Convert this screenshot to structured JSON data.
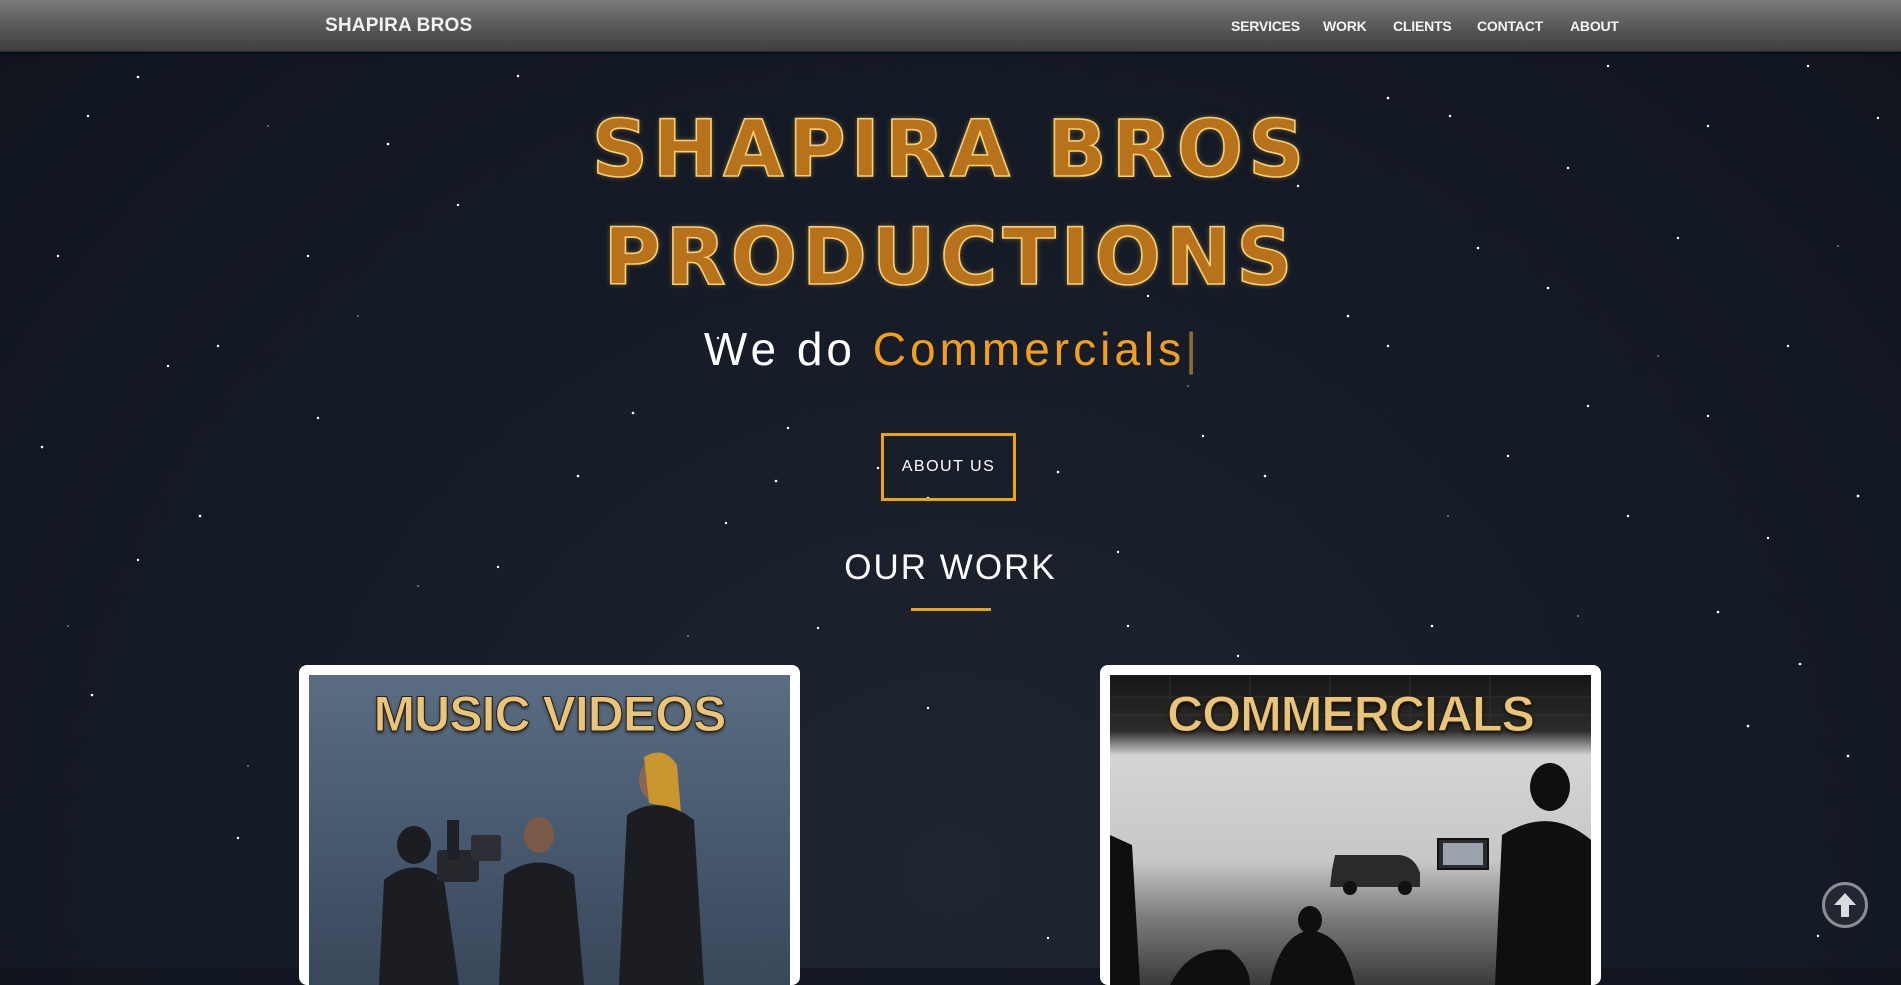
{
  "navbar": {
    "brand": "SHAPIRA BROS",
    "links": [
      "SERVICES",
      "WORK",
      "CLIENTS",
      "CONTACT",
      "ABOUT"
    ]
  },
  "hero": {
    "title_line1": "SHAPIRA BROS",
    "title_line2": "PRODUCTIONS",
    "tagline_prefix": "We do ",
    "tagline_word": "Commercials",
    "tagline_cursor": "|",
    "about_button": "ABOUT US"
  },
  "work": {
    "heading": "OUR WORK",
    "cards": [
      {
        "label": "MUSIC VIDEOS"
      },
      {
        "label": "COMMERCIALS"
      }
    ]
  },
  "colors": {
    "accent": "#f29f1e",
    "title_gold": "#b8731a",
    "button_border": "#f1a20f",
    "background": "#151b26"
  },
  "icons": {
    "scroll_top": "arrow-up-circle-icon"
  }
}
